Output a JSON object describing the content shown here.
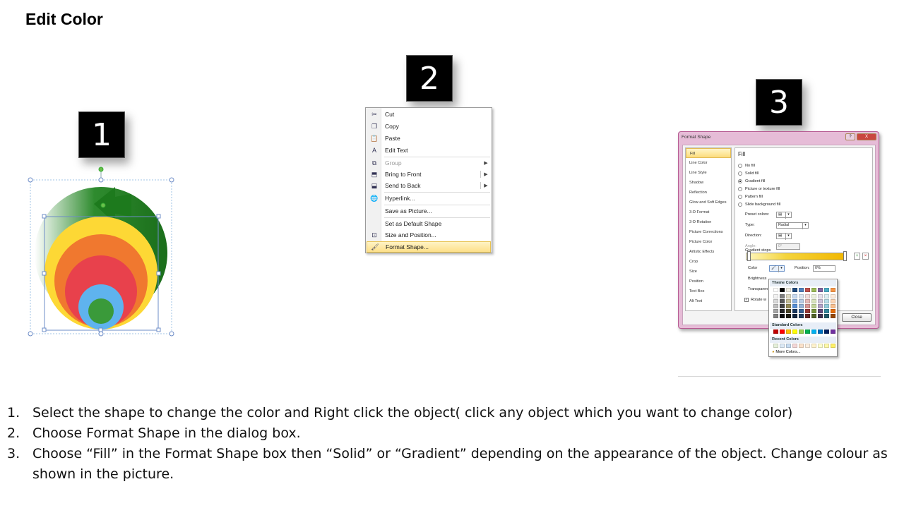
{
  "page": {
    "title": "Edit Color"
  },
  "steps": [
    {
      "number": "1"
    },
    {
      "number": "2"
    },
    {
      "number": "3"
    }
  ],
  "context_menu": {
    "items": [
      {
        "label": "Cut",
        "icon": "scissors-icon"
      },
      {
        "label": "Copy",
        "icon": "copy-icon"
      },
      {
        "label": "Paste",
        "icon": "paste-icon"
      },
      {
        "label": "Edit Text",
        "icon": "edit-text-icon"
      },
      {
        "label": "Group",
        "icon": "group-icon",
        "disabled": true
      },
      {
        "label": "Bring to Front",
        "icon": "bring-to-front-icon"
      },
      {
        "label": "Send to Back",
        "icon": "send-to-back-icon"
      },
      {
        "label": "Hyperlink...",
        "icon": "hyperlink-icon"
      },
      {
        "label": "Save as Picture..."
      },
      {
        "label": "Set as Default Shape"
      },
      {
        "label": "Size and Position...",
        "icon": "size-position-icon"
      },
      {
        "label": "Format Shape...",
        "icon": "format-shape-icon",
        "highlighted": true
      }
    ]
  },
  "format_dialog": {
    "title": "Format Shape",
    "help_button": "?",
    "close_x": "X",
    "nav": [
      "Fill",
      "Line Color",
      "Line Style",
      "Shadow",
      "Reflection",
      "Glow and Soft Edges",
      "3-D Format",
      "3-D Rotation",
      "Picture Corrections",
      "Picture Color",
      "Artistic Effects",
      "Crop",
      "Size",
      "Position",
      "Text Box",
      "Alt Text"
    ],
    "section": "Fill",
    "fill_options": [
      "No fill",
      "Solid fill",
      "Gradient fill",
      "Picture or texture fill",
      "Pattern fill",
      "Slide background fill"
    ],
    "selected_fill": "Gradient fill",
    "preset_label": "Preset colors:",
    "type_label": "Type:",
    "type_value": "Radial",
    "direction_label": "Direction:",
    "angle_label": "Angle:",
    "angle_value": "0°",
    "gradient_stops_label": "Gradient stops",
    "color_label": "Color",
    "position_label": "Position:",
    "position_value": "0%",
    "brightness_label": "Brightness",
    "transparency_label": "Transparen",
    "rotate_label": "Rotate w",
    "close_button": "Close"
  },
  "color_popup": {
    "theme_label": "Theme Colors",
    "standard_label": "Standard Colors",
    "recent_label": "Recent Colors",
    "more_label": "More Colors...",
    "theme_top": [
      "#ffffff",
      "#000000",
      "#eeece1",
      "#1f497d",
      "#4f81bd",
      "#c0504d",
      "#9bbb59",
      "#8064a2",
      "#4bacc6",
      "#f79646"
    ],
    "theme_cols": [
      [
        "#f2f2f2",
        "#d9d9d9",
        "#bfbfbf",
        "#a6a6a6",
        "#808080"
      ],
      [
        "#7f7f7f",
        "#595959",
        "#404040",
        "#262626",
        "#0d0d0d"
      ],
      [
        "#ddd9c3",
        "#c4bd97",
        "#938953",
        "#494429",
        "#1d1b10"
      ],
      [
        "#c6d9f0",
        "#8db3e2",
        "#548dd4",
        "#17365d",
        "#0f243e"
      ],
      [
        "#dbe5f1",
        "#b8cce4",
        "#95b3d7",
        "#366092",
        "#244061"
      ],
      [
        "#f2dcdb",
        "#e5b9b7",
        "#d99694",
        "#953734",
        "#632423"
      ],
      [
        "#ebf1dd",
        "#d7e3bc",
        "#c3d69b",
        "#76923c",
        "#4f6128"
      ],
      [
        "#e5e0ec",
        "#ccc1d9",
        "#b2a2c7",
        "#5f497a",
        "#3f3151"
      ],
      [
        "#dbeef3",
        "#b7dde8",
        "#92cddc",
        "#31859b",
        "#205867"
      ],
      [
        "#fdeada",
        "#fbd5b5",
        "#fac08f",
        "#e36c09",
        "#974806"
      ]
    ],
    "standard": [
      "#c00000",
      "#ff0000",
      "#ffc000",
      "#ffff00",
      "#92d050",
      "#00b050",
      "#00b0f0",
      "#0070c0",
      "#002060",
      "#7030a0"
    ],
    "recent": [
      "#e4efd9",
      "#dbe8f5",
      "#c6dbf0",
      "#f3d6d6",
      "#fbe1c9",
      "#fdeede",
      "#fff2cc",
      "#ffffcc",
      "#fff9a8",
      "#fff066"
    ]
  },
  "instructions": [
    {
      "num": "1.",
      "text": "Select the shape to change the color and Right click the object( click any object which you want to change color)"
    },
    {
      "num": "2.",
      "text": "Choose Format Shape in the dialog box."
    },
    {
      "num": "3.",
      "text": "Choose “Fill” in the Format Shape box then “Solid” or “Gradient” depending on the appearance of the object. Change colour as shown in the picture."
    }
  ]
}
